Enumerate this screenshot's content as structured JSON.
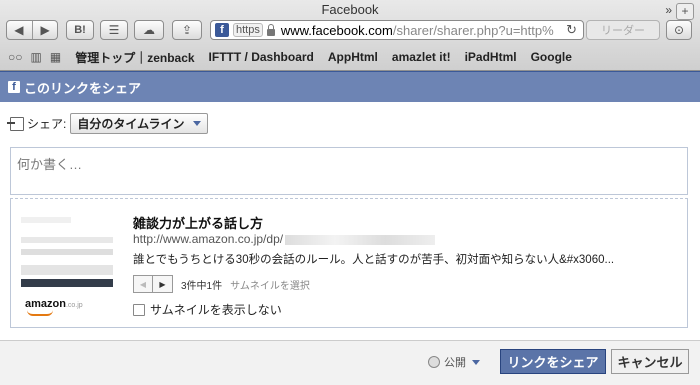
{
  "browser": {
    "window_title": "Facebook",
    "url_https": "https",
    "url_host": "www.facebook.com",
    "url_rest": "/sharer/sharer.php?u=http%",
    "reader_label": "リーダー",
    "bookmarks": [
      "管理トップ｜zenback",
      "IFTTT / Dashboard",
      "AppHtml",
      "amazlet it!",
      "iPadHtml",
      "Google"
    ]
  },
  "dialog": {
    "title": "このリンクをシェア",
    "share_label": "シェア:",
    "share_target": "自分のタイムライン",
    "compose_placeholder": "何か書く…",
    "attachment": {
      "title": "雑談力が上がる話し方",
      "url": "http://www.amazon.co.jp/dp/",
      "description": "誰とでもうちとける30秒の会話のルール。人と話すのが苦手、初対面や知らない人&#x3060...",
      "brand": "amazon",
      "brand_suffix": ".co.jp",
      "pager_count": "3件中1件",
      "select_thumbnail": "サムネイルを選択",
      "no_thumbnail_label": "サムネイルを表示しない"
    },
    "privacy": "公開",
    "share_button": "リンクをシェア",
    "cancel_button": "キャンセル"
  }
}
